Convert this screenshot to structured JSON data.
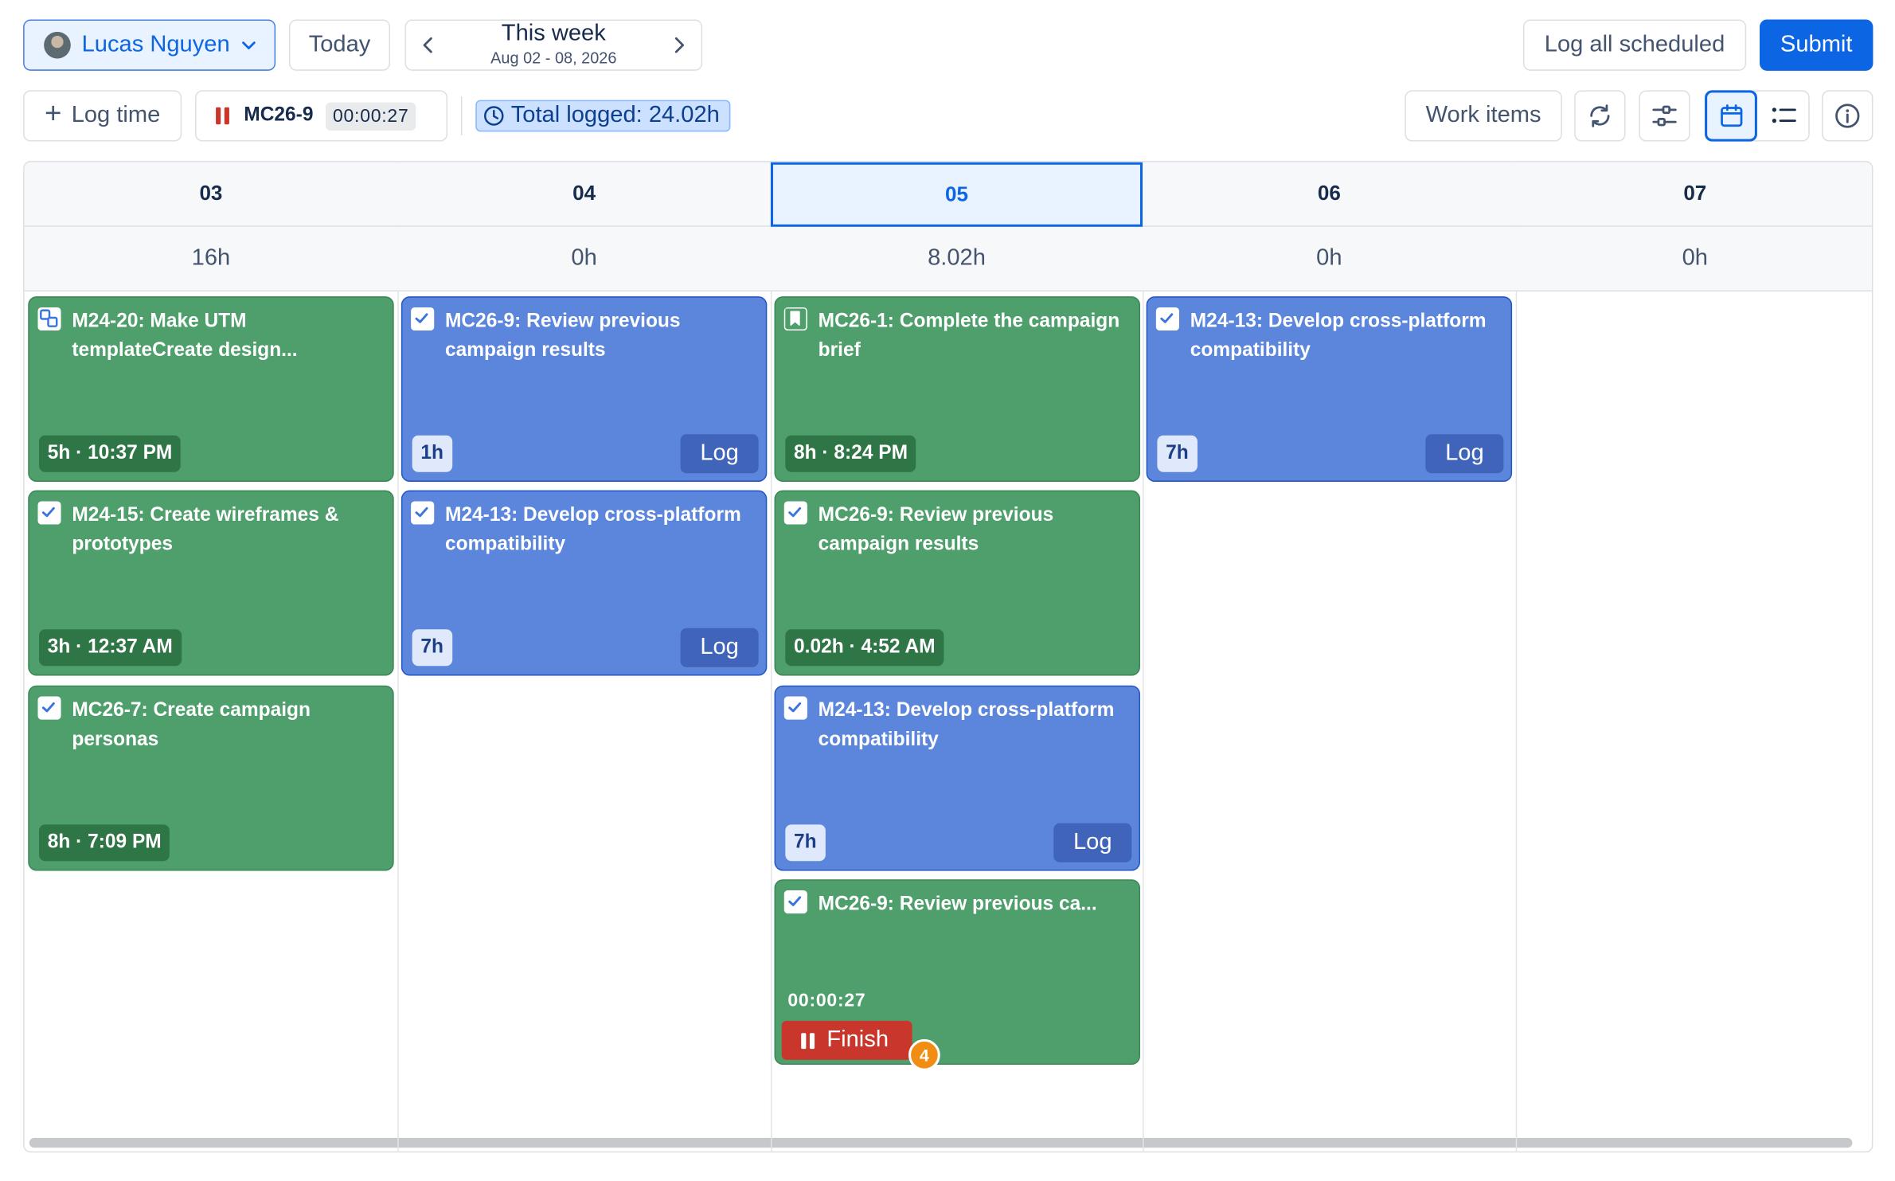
{
  "toolbar": {
    "user_name": "Lucas Nguyen",
    "today_label": "Today",
    "week_title": "This week",
    "week_range": "Aug 02 - 08, 2026",
    "log_all_label": "Log all scheduled",
    "submit_label": "Submit",
    "log_time_label": "Log time",
    "active_timer_key": "MC26-9",
    "active_timer_time": "00:00:27",
    "total_logged": "Total logged: 24.02h",
    "work_items_label": "Work items"
  },
  "calendar": {
    "days": [
      {
        "label": "03",
        "hours": "16h"
      },
      {
        "label": "04",
        "hours": "0h"
      },
      {
        "label": "05",
        "hours": "8.02h",
        "today": true
      },
      {
        "label": "06",
        "hours": "0h"
      },
      {
        "label": "07",
        "hours": "0h"
      }
    ],
    "entries": [
      {
        "day": "03",
        "title": "M24-20: Make UTM templateCreate design...",
        "meta": "5h · 10:37 PM",
        "status": "logged",
        "icon": "subtask-icon"
      },
      {
        "day": "03",
        "title": "M24-15: Create wireframes & prototypes",
        "meta": "3h · 12:37 AM",
        "status": "logged",
        "icon": "task-checkbox-icon"
      },
      {
        "day": "03",
        "title": "MC26-7: Create campaign personas",
        "meta": "8h · 7:09 PM",
        "status": "logged",
        "icon": "task-checkbox-icon"
      },
      {
        "day": "04",
        "title": "MC26-9: Review previous campaign results",
        "meta": "1h",
        "status": "scheduled",
        "action": "Log",
        "icon": "task-checkbox-icon"
      },
      {
        "day": "04",
        "title": "M24-13: Develop cross-platform compatibility",
        "meta": "7h",
        "status": "scheduled",
        "action": "Log",
        "icon": "task-checkbox-icon"
      },
      {
        "day": "05",
        "title": "MC26-1: Complete the campaign brief",
        "meta": "8h · 8:24 PM",
        "status": "logged",
        "icon": "story-bookmark-icon"
      },
      {
        "day": "05",
        "title": "MC26-9: Review previous campaign results",
        "meta": "0.02h · 4:52 AM",
        "status": "logged",
        "icon": "task-checkbox-icon"
      },
      {
        "day": "05",
        "title": "M24-13: Develop cross-platform compatibility",
        "meta": "7h",
        "status": "scheduled",
        "action": "Log",
        "icon": "task-checkbox-icon"
      },
      {
        "day": "05",
        "title": "MC26-9: Review previous ca...",
        "timer": "00:00:27",
        "status": "running",
        "action": "Finish",
        "badge": "4",
        "icon": "task-checkbox-icon"
      },
      {
        "day": "06",
        "title": "M24-13: Develop cross-platform compatibility",
        "meta": "7h",
        "status": "scheduled",
        "action": "Log",
        "icon": "task-checkbox-icon"
      }
    ]
  },
  "colors": {
    "primary": "#0c66e4",
    "logged_card": "#4e9f6b",
    "scheduled_card": "#5b86dc",
    "finish_button": "#c9372c",
    "notification_badge": "#f18d13"
  }
}
